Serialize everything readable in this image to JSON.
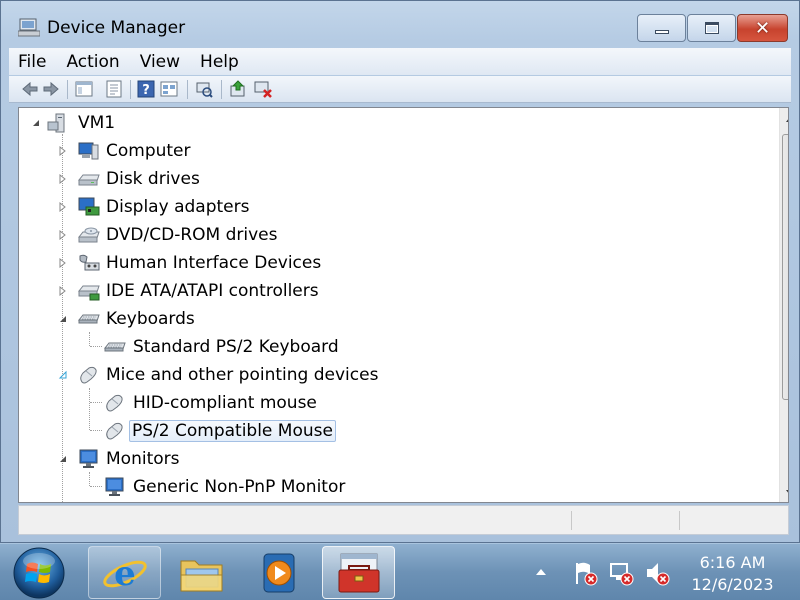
{
  "window": {
    "title": "Device Manager",
    "buttons": {
      "minimize": "minimize",
      "maximize": "maximize",
      "close": "✕"
    }
  },
  "menu": [
    "File",
    "Action",
    "View",
    "Help"
  ],
  "toolbar_icons": [
    "back-arrow-icon",
    "forward-arrow-icon",
    "show-hide-console-tree-icon",
    "properties-icon",
    "help-icon",
    "view-icon",
    "scan-hardware-icon",
    "update-driver-icon",
    "uninstall-icon"
  ],
  "tree": {
    "root": "VM1",
    "items": [
      {
        "label": "Computer",
        "expanded": false
      },
      {
        "label": "Disk drives",
        "expanded": false
      },
      {
        "label": "Display adapters",
        "expanded": false
      },
      {
        "label": "DVD/CD-ROM drives",
        "expanded": false
      },
      {
        "label": "Human Interface Devices",
        "expanded": false
      },
      {
        "label": "IDE ATA/ATAPI controllers",
        "expanded": false
      },
      {
        "label": "Keyboards",
        "expanded": true,
        "children": [
          "Standard PS/2 Keyboard"
        ]
      },
      {
        "label": "Mice and other pointing devices",
        "expanded": true,
        "children": [
          "HID-compliant mouse",
          "PS/2 Compatible Mouse"
        ]
      },
      {
        "label": "Monitors",
        "expanded": true,
        "children": [
          "Generic Non-PnP Monitor"
        ]
      }
    ],
    "selected": "PS/2 Compatible Mouse"
  },
  "taskbar": {
    "apps": [
      "internet-explorer",
      "windows-explorer",
      "windows-media-player",
      "device-manager"
    ],
    "active_app": "device-manager"
  },
  "clock": {
    "time": "6:16 AM",
    "date": "12/6/2023"
  },
  "colors": {
    "title_bar": "#b5cbe3",
    "close_button": "#c7432e",
    "selection_border": "#a4c0e4",
    "taskbar": "#6d92b6"
  }
}
